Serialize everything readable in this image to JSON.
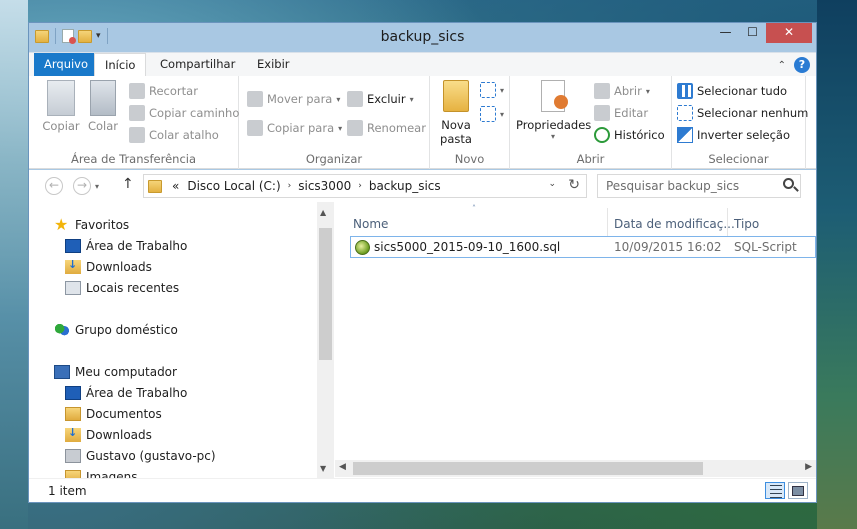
{
  "window": {
    "title": "backup_sics",
    "controls": {
      "minimize": "—",
      "maximize": "☐",
      "close": "✕"
    }
  },
  "quick_access": {
    "dropdown": "▾"
  },
  "ribbon_tabs": [
    {
      "label": "Arquivo"
    },
    {
      "label": "Início"
    },
    {
      "label": "Compartilhar"
    },
    {
      "label": "Exibir"
    }
  ],
  "ribbon_controls": {
    "collapse": "⌃",
    "help": "?"
  },
  "ribbon": {
    "clipboard": {
      "label": "Área de Transferência",
      "copy": "Copiar",
      "paste": "Colar",
      "cut": "Recortar",
      "copy_path": "Copiar caminho",
      "paste_shortcut": "Colar atalho"
    },
    "organize": {
      "label": "Organizar",
      "move_to": "Mover para",
      "copy_to": "Copiar para",
      "delete": "Excluir",
      "rename": "Renomear"
    },
    "new": {
      "label": "Novo",
      "new_folder_line1": "Nova",
      "new_folder_line2": "pasta"
    },
    "open": {
      "label": "Abrir",
      "properties": "Propriedades",
      "open": "Abrir",
      "edit": "Editar",
      "history": "Histórico"
    },
    "select": {
      "label": "Selecionar",
      "select_all": "Selecionar tudo",
      "select_none": "Selecionar nenhum",
      "invert": "Inverter seleção"
    }
  },
  "address_bar": {
    "back": "←",
    "forward": "→",
    "up": "↑",
    "overflow": "«",
    "crumbs": [
      "Disco Local (C:)",
      "sics3000",
      "backup_sics"
    ],
    "separator": "›",
    "dropdown": "⌄",
    "refresh": "↻"
  },
  "search": {
    "placeholder": "Pesquisar backup_sics"
  },
  "nav_pane": {
    "favorites": "Favoritos",
    "fav_items": [
      "Área de Trabalho",
      "Downloads",
      "Locais recentes"
    ],
    "homegroup": "Grupo doméstico",
    "computer": "Meu computador",
    "pc_items": [
      "Área de Trabalho",
      "Documentos",
      "Downloads",
      "Gustavo (gustavo-pc)",
      "Imagens"
    ]
  },
  "file_list": {
    "columns": [
      "Nome",
      "Data de modificaç...",
      "Tipo"
    ],
    "sort_indicator": "˄",
    "rows": [
      {
        "name": "sics5000_2015-09-10_1600.sql",
        "modified": "10/09/2015 16:02",
        "type": "SQL-Script"
      }
    ]
  },
  "status_bar": {
    "text": "1 item"
  }
}
